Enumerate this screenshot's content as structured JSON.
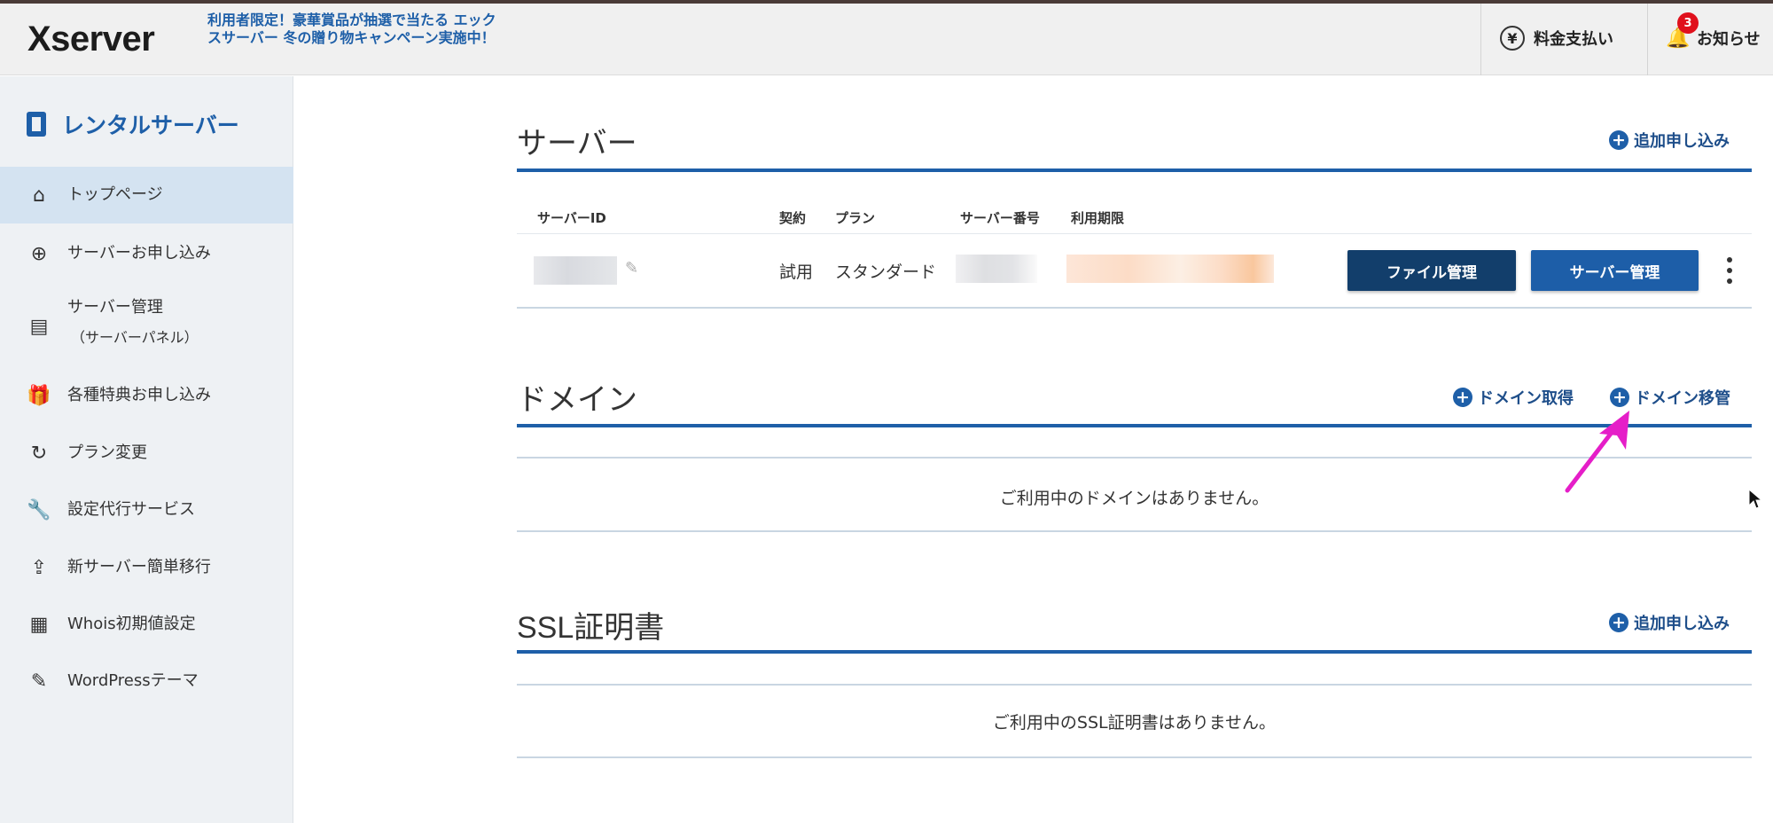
{
  "header": {
    "logo": "Xserver",
    "promo": "利用者限定！豪華賞品が抽選で当たる エックスサーバー 冬の贈り物キャンペーン実施中！",
    "pay_label": "料金支払い",
    "pay_icon": "yen-icon",
    "news_label": "お知らせ",
    "news_icon": "bell-icon",
    "news_badge": "3"
  },
  "sidebar": {
    "title": "レンタルサーバー",
    "items": [
      {
        "label": "トップページ",
        "icon": "home-icon",
        "active": true
      },
      {
        "label": "サーバーお申し込み",
        "icon": "plus-circle-icon"
      },
      {
        "label": "サーバー管理",
        "sub": "（サーバーパネル）",
        "icon": "server-icon"
      },
      {
        "label": "各種特典お申し込み",
        "icon": "gift-icon"
      },
      {
        "label": "プラン変更",
        "icon": "refresh-icon"
      },
      {
        "label": "設定代行サービス",
        "icon": "wrench-icon"
      },
      {
        "label": "新サーバー簡単移行",
        "icon": "upload-icon"
      },
      {
        "label": "Whois初期値設定",
        "icon": "document-icon"
      },
      {
        "label": "WordPressテーマ",
        "icon": "edit-icon"
      }
    ]
  },
  "server_section": {
    "title": "サーバー",
    "add_label": "追加申し込み",
    "columns": [
      "サーバーID",
      "契約",
      "プラン",
      "サーバー番号",
      "利用期限"
    ],
    "row": {
      "contract": "試用",
      "plan": "スタンダード",
      "file_button": "ファイル管理",
      "server_button": "サーバー管理"
    }
  },
  "domain_section": {
    "title": "ドメイン",
    "acquire_label": "ドメイン取得",
    "transfer_label": "ドメイン移管",
    "empty": "ご利用中のドメインはありません。"
  },
  "ssl_section": {
    "title": "SSL証明書",
    "add_label": "追加申し込み",
    "empty": "ご利用中のSSL証明書はありません。"
  },
  "colors": {
    "accent": "#1e5fa8",
    "dark_button": "#123e6b",
    "badge": "#e0101c",
    "arrow": "#e51ec8"
  }
}
